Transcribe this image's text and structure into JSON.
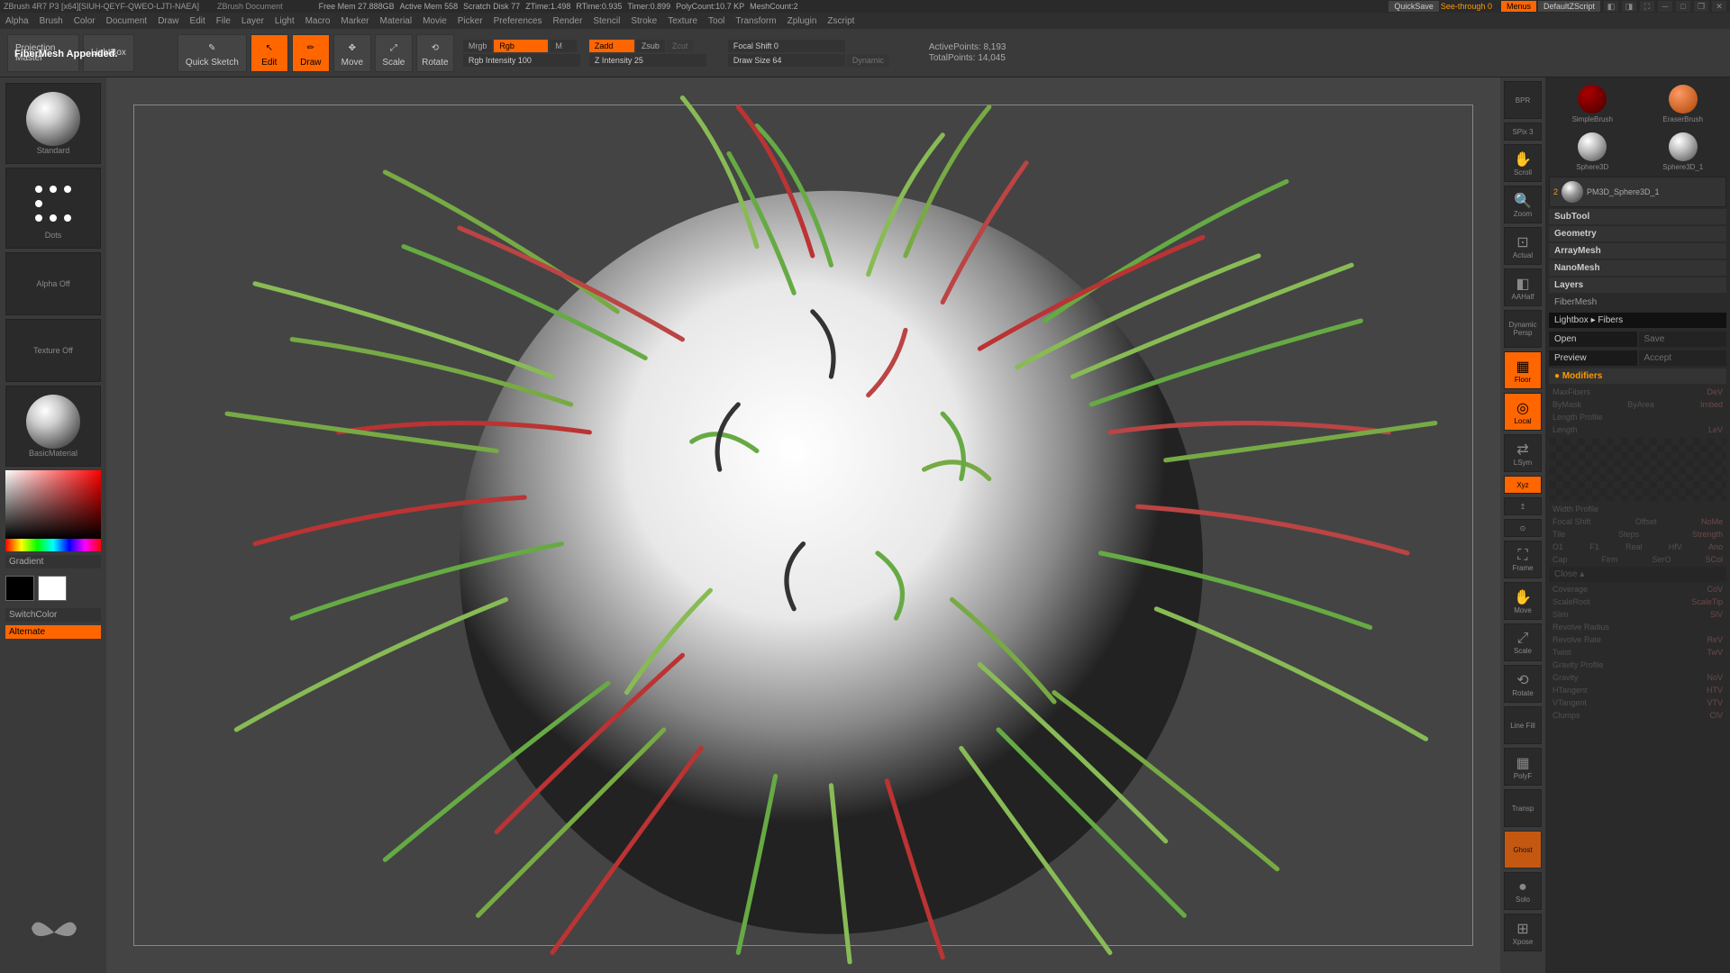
{
  "title_bar": {
    "app": "ZBrush 4R7 P3 [x64][SIUH-QEYF-QWEO-LJTI-NAEA]",
    "document": "ZBrush Document",
    "stats": {
      "free_mem": "Free Mem 27.888GB",
      "active_mem": "Active Mem 558",
      "scratch": "Scratch Disk 77",
      "ztime": "ZTime:1.498",
      "rtime": "RTime:0.935",
      "timer": "Timer:0.899",
      "polycount": "PolyCount:10.7 KP",
      "meshcount": "MeshCount:2"
    },
    "quicksave": "QuickSave",
    "see_through": "See-through 0",
    "menus": "Menus",
    "script": "DefaultZScript"
  },
  "menu": [
    "Alpha",
    "Brush",
    "Color",
    "Document",
    "Draw",
    "Edit",
    "File",
    "Layer",
    "Light",
    "Macro",
    "Marker",
    "Material",
    "Movie",
    "Picker",
    "Preferences",
    "Render",
    "Stencil",
    "Stroke",
    "Texture",
    "Tool",
    "Transform",
    "Zplugin",
    "Zscript"
  ],
  "status_message": "FiberMesh Appended.",
  "toolbar": {
    "projection": "Projection Master",
    "lightbox": "LightBox",
    "quicksketch": "Quick Sketch",
    "edit": "Edit",
    "draw": "Draw",
    "move": "Move",
    "scale": "Scale",
    "rotate": "Rotate",
    "mrgb": "Mrgb",
    "rgb": "Rgb",
    "m": "M",
    "rgb_intensity": "Rgb Intensity 100",
    "zadd": "Zadd",
    "zsub": "Zsub",
    "zcut": "Zcut",
    "z_intensity": "Z Intensity 25",
    "focal_shift": "Focal Shift 0",
    "draw_size": "Draw Size 64",
    "dynamic": "Dynamic",
    "active_points": "ActivePoints: 8,193",
    "total_points": "TotalPoints: 14,045"
  },
  "left_panel": {
    "standard": "Standard",
    "dots": "Dots",
    "alpha_off": "Alpha Off",
    "texture_off": "Texture Off",
    "basic_material": "BasicMaterial",
    "gradient": "Gradient",
    "switch_color": "SwitchColor",
    "alternate": "Alternate"
  },
  "right_toolbar": {
    "bpr": "BPR",
    "spix": "SPix 3",
    "scroll": "Scroll",
    "zoom": "Zoom",
    "actual": "Actual",
    "aahalf": "AAHalf",
    "persp": "Persp",
    "dynamic_persp": "Dynamic",
    "floor": "Floor",
    "local": "Local",
    "lsym": "LSym",
    "xyz": "Xyz",
    "frame": "Frame",
    "move": "Move",
    "scale": "Scale",
    "rotate": "Rotate",
    "linefill": "Line Fill",
    "polyf": "PolyF",
    "transp": "Transp",
    "ghost": "Ghost",
    "solo": "Solo",
    "xpose": "Xpose"
  },
  "right_panel": {
    "thumbs": {
      "simple": "SimpleBrush",
      "eraser": "EraserBrush",
      "sphere3d": "Sphere3D",
      "sphere3d1": "Sphere3D_1"
    },
    "subtool_active": "PM3D_Sphere3D_1",
    "sections": {
      "subtool": "SubTool",
      "geometry": "Geometry",
      "arraymesh": "ArrayMesh",
      "nanomesh": "NanoMesh",
      "layers": "Layers",
      "fibermesh": "FiberMesh",
      "lightbox_fibers": "Lightbox ▸ Fibers",
      "open": "Open",
      "save": "Save",
      "preview": "Preview",
      "accept": "Accept",
      "modifiers": "Modifiers",
      "close": "Close ▴"
    },
    "modifiers": {
      "maxfibers": "MaxFibers",
      "dev": "DeV",
      "bymask": "ByMask",
      "byarea": "ByArea",
      "imbed": "Imbed",
      "length_profile": "Length Profile",
      "length": "Length",
      "lev": "LeV",
      "width_profile": "Width Profile",
      "focal_shift": "Focal Shift",
      "offset": "Offset",
      "nome": "NoMe",
      "tile": "Tile",
      "steps": "Steps",
      "strength": "Strength",
      "o1": "O1",
      "f1": "F1",
      "real": "Real",
      "hfv": "HfV",
      "ano": "Ano",
      "cap": "Cap",
      "firm": "Firm",
      "sero": "SerO",
      "scol": "SCol",
      "coverage": "Coverage",
      "cov": "CoV",
      "scaleroot": "ScaleRoot",
      "scaletip": "ScaleTip",
      "slim": "Slim",
      "slv": "SlV",
      "revolve_radius": "Revolve Radius",
      "revolve_rate": "Revolve Rate",
      "rev": "ReV",
      "twist": "Twist",
      "twv": "TwV",
      "gravity_profile": "Gravity Profile",
      "gravity": "Gravity",
      "nov": "NoV",
      "htangent": "HTangent",
      "htv": "HTV",
      "vtangent": "VTangent",
      "vtv": "VTV",
      "clumps": "Clumps",
      "clv": "ClV"
    }
  }
}
